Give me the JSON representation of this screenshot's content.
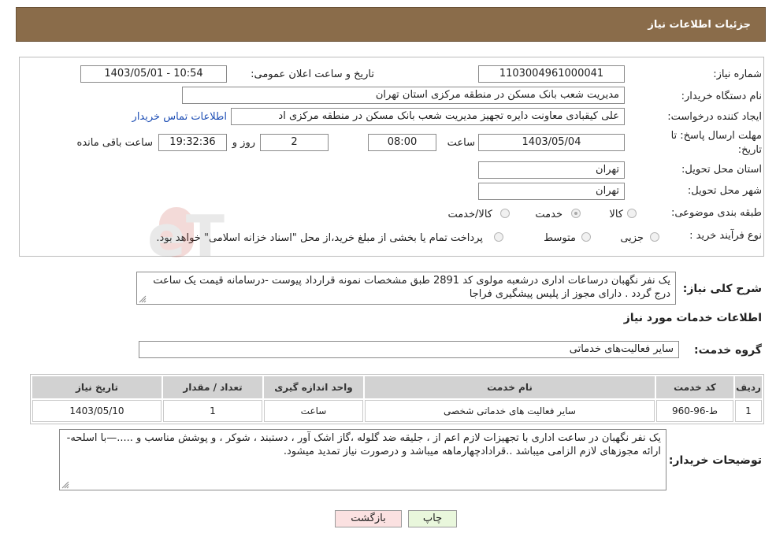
{
  "header": {
    "title": "جزئیات اطلاعات نیاز"
  },
  "form": {
    "need_number_label": "شماره نیاز:",
    "need_number": "1103004961000041",
    "announce_label": "تاریخ و ساعت اعلان عمومی:",
    "announce_value": "1403/05/01 - 10:54",
    "buyer_org_label": "نام دستگاه خریدار:",
    "buyer_org": "مدیریت شعب بانک مسکن در منطقه مرکزی استان تهران",
    "creator_label": "ایجاد کننده درخواست:",
    "creator": "علی کیقبادی معاونت دایره تجهیز مدیریت شعب بانک مسکن در منطقه مرکزی اد",
    "contact_link": "اطلاعات تماس خریدار",
    "deadline_label_1": "مهلت ارسال پاسخ: تا",
    "deadline_label_2": "تاریخ:",
    "deadline_date": "1403/05/04",
    "hour_label": "ساعت",
    "deadline_time": "08:00",
    "days_value": "2",
    "days_label": "روز و",
    "remaining_time": "19:32:36",
    "remaining_label": "ساعت باقی مانده",
    "province_label": "استان محل تحویل:",
    "province": "تهران",
    "city_label": "شهر محل تحویل:",
    "city": "تهران",
    "category_label": "طبقه بندی موضوعی:",
    "category_options": [
      "کالا",
      "خدمت",
      "کالا/خدمت"
    ],
    "category_selected": "خدمت",
    "process_label": "نوع فرآیند خرید :",
    "process_options": [
      "جزیی",
      "متوسط"
    ],
    "payment_note": "پرداخت تمام یا بخشی از مبلغ خرید،از محل \"اسناد خزانه اسلامی\" خواهد بود."
  },
  "summary": {
    "label": "شرح کلی نیاز:",
    "text": "یک نفر نگهبان درساعات اداری درشعبه مولوی کد 2891 طبق مشخصات نمونه قرارداد پیوست -درسامانه قیمت یک ساعت درج گردد . دارای مجوز از پلیس پیشگیری فراجا"
  },
  "services": {
    "section_title": "اطلاعات خدمات مورد نیاز",
    "group_label": "گروه خدمت:",
    "group_value": "سایر فعالیت‌های خدماتی",
    "columns": [
      "ردیف",
      "کد خدمت",
      "نام خدمت",
      "واحد اندازه گیری",
      "تعداد / مقدار",
      "تاریخ نیاز"
    ],
    "rows": [
      [
        "1",
        "ط-96-960",
        "سایر فعالیت های خدماتی شخصی",
        "ساعت",
        "1",
        "1403/05/10"
      ]
    ]
  },
  "buyer_notes": {
    "label": "توضیحات خریدار:",
    "text": "یک نفر نگهبان در ساعت اداری با تجهیزات لازم اعم از ، جلیقه ضد گلوله ،گاز اشک آور ، دستبند ، شوکر ، و پوشش مناسب و .....—با اسلحه- ارائه مجوزهای لازم الزامی میباشد ..قرادادچهارماهه میباشد و درصورت نیاز تمدید میشود."
  },
  "actions": {
    "print": "چاپ",
    "back": "بازگشت"
  },
  "watermark": {
    "text": "AriaTender.neT"
  },
  "colors": {
    "header": "#8a6c4a",
    "link": "#1f4fb5",
    "print_btn": "#e9f7dc",
    "back_btn": "#fbe1e1"
  }
}
